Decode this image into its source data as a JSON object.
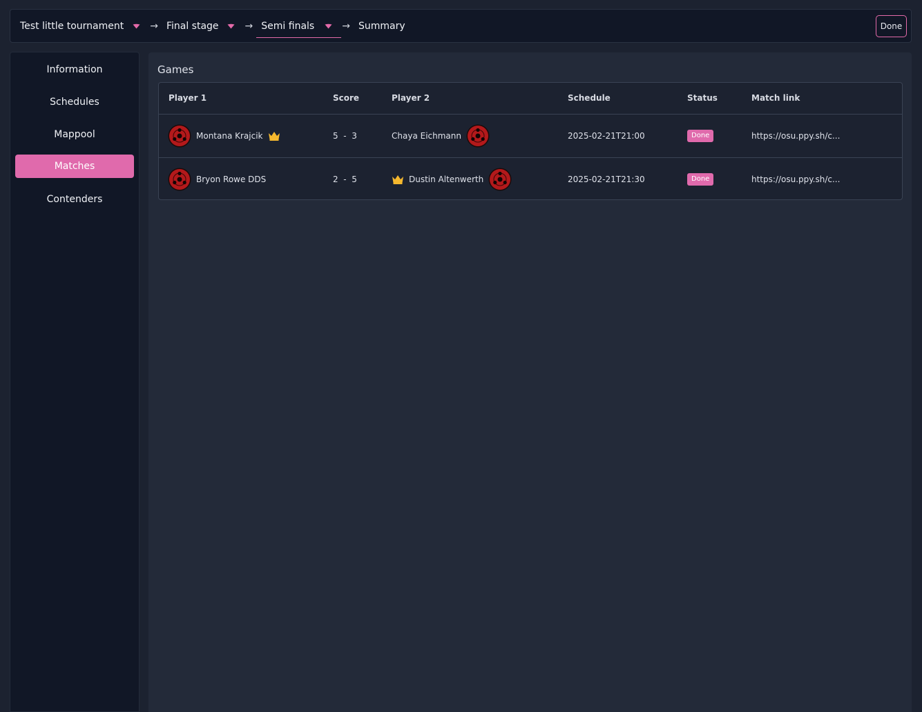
{
  "breadcrumb": [
    {
      "label": "Test little tournament",
      "has_dropdown": true
    },
    {
      "label": "Final stage",
      "has_dropdown": true
    },
    {
      "label": "Semi finals",
      "has_dropdown": true,
      "active": true
    },
    {
      "label": "Summary",
      "has_dropdown": false
    }
  ],
  "topbar": {
    "done_label": "Done"
  },
  "sidebar": {
    "items": [
      {
        "label": "Information"
      },
      {
        "label": "Schedules"
      },
      {
        "label": "Mappool"
      },
      {
        "label": "Matches",
        "active": true
      },
      {
        "label": "Contenders"
      }
    ]
  },
  "main": {
    "title": "Games",
    "columns": [
      "Player 1",
      "Score",
      "Player 2",
      "Schedule",
      "Status",
      "Match link"
    ],
    "rows": [
      {
        "player1": "Montana Krajcik",
        "winner": "player1",
        "score": "5  -  3",
        "player2": "Chaya Eichmann",
        "schedule": "2025-02-21T21:00",
        "status": "Done",
        "link": "https://osu.ppy.sh/c..."
      },
      {
        "player1": "Bryon Rowe DDS",
        "winner": "player2",
        "score": "2  -  5",
        "player2": "Dustin Altenwerth",
        "schedule": "2025-02-21T21:30",
        "status": "Done",
        "link": "https://osu.ppy.sh/c..."
      }
    ]
  },
  "colors": {
    "accent": "#e06aac",
    "crown": "#f5b82e",
    "avatar": "#b3191b"
  },
  "icons": {
    "dropdown": "caret-down-icon",
    "separator": "arrow-right-icon",
    "winner": "crown-icon",
    "avatar": "sharingan-avatar-icon"
  }
}
